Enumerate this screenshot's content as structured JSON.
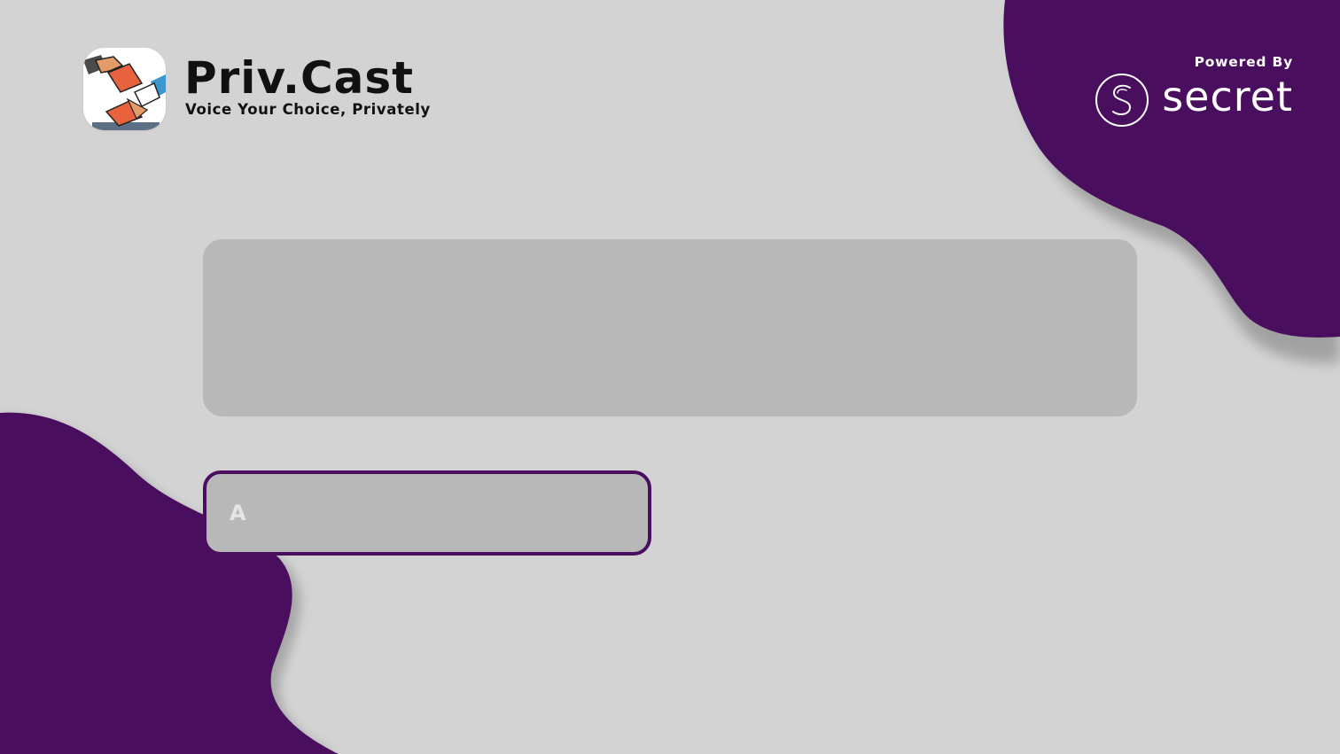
{
  "brand": {
    "name": "Priv.Cast",
    "tagline": "Voice Your Choice, Privately"
  },
  "powered_by": {
    "label": "Powered By",
    "name": "secret"
  },
  "question": {
    "text": ""
  },
  "options": [
    {
      "letter": "A",
      "text": ""
    }
  ],
  "colors": {
    "background": "#d3d3d3",
    "accent_purple": "#4a0e5e",
    "panel": "#b8b8b8",
    "text_dark": "#111111",
    "text_light": "#ffffff"
  },
  "icons": {
    "app_logo": "ballot-hands-icon",
    "partner_logo": "secret-network-icon"
  }
}
